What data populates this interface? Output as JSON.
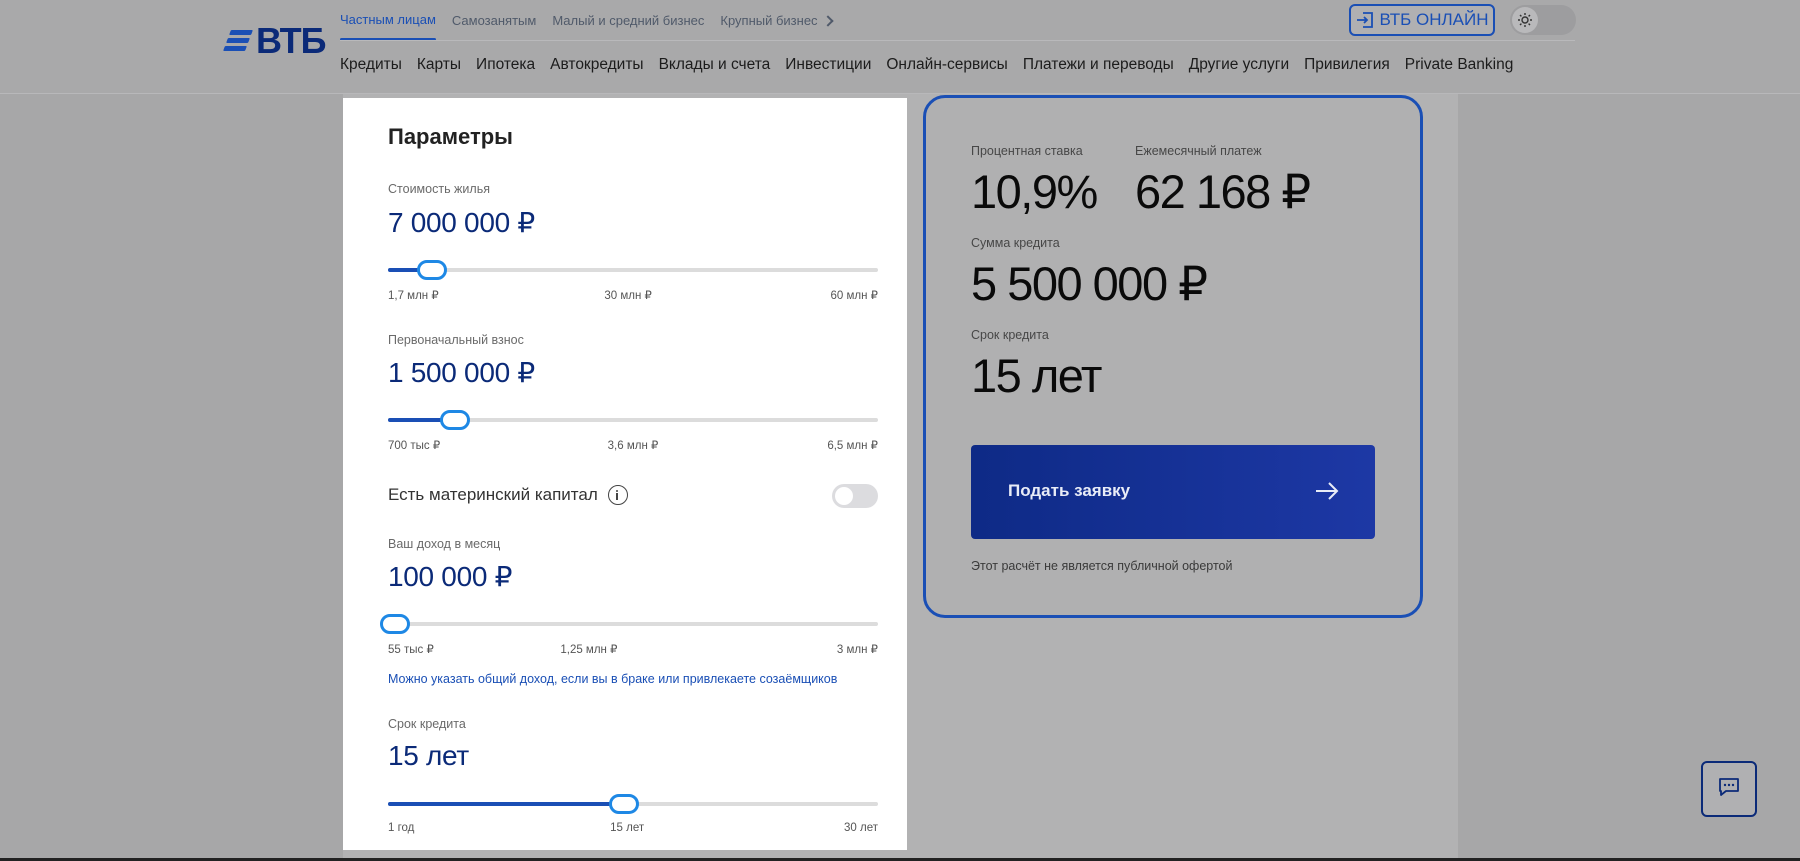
{
  "header": {
    "logo_text": "ВТБ",
    "segment_tabs": [
      {
        "label": "Частным лицам",
        "active": true
      },
      {
        "label": "Самозанятым",
        "active": false
      },
      {
        "label": "Малый и средний бизнес",
        "active": false
      },
      {
        "label": "Крупный бизнес",
        "active": false
      }
    ],
    "online_button": "ВТБ ОНЛАЙН",
    "theme_toggle_icon": "sun-icon",
    "nav": [
      "Кредиты",
      "Карты",
      "Ипотека",
      "Автокредиты",
      "Вклады и счета",
      "Инвестиции",
      "Онлайн-сервисы",
      "Платежи и переводы",
      "Другие услуги",
      "Привилегия",
      "Private Banking"
    ]
  },
  "params": {
    "title": "Параметры",
    "fields": [
      {
        "label": "Стоимость жилья",
        "value": "7 000 000 ₽",
        "slider_fraction": 0.09,
        "ticks": [
          "1,7 млн ₽",
          "30 млн ₽",
          "60 млн ₽"
        ],
        "mid_tick_fraction": 0.49
      },
      {
        "label": "Первоначальный взнос",
        "value": "1 500 000 ₽",
        "slider_fraction": 0.137,
        "ticks": [
          "700 тыс ₽",
          "3,6 млн ₽",
          "6,5 млн ₽"
        ],
        "mid_tick_fraction": 0.5
      },
      {
        "label": "Ваш доход в месяц",
        "value": "100 000 ₽",
        "slider_fraction": 0.015,
        "ticks": [
          "55 тыс ₽",
          "1,25 млн ₽",
          "3 млн ₽"
        ],
        "mid_tick_fraction": 0.41
      },
      {
        "label": "Срок кредита",
        "value": "15 лет",
        "slider_fraction": 0.482,
        "ticks": [
          "1 год",
          "15 лет",
          "30 лет"
        ],
        "mid_tick_fraction": 0.488
      }
    ],
    "maternity_capital": {
      "label": "Есть материнский капитал",
      "enabled": false
    },
    "income_hint": "Можно указать общий доход, если вы в браке или привлекаете созаёмщиков"
  },
  "result": {
    "rate_label": "Процентная ставка",
    "rate_value": "10,9%",
    "payment_label": "Ежемесячный платеж",
    "payment_value": "62 168 ₽",
    "amount_label": "Сумма кредита",
    "amount_value": "5 500 000 ₽",
    "term_label": "Срок кредита",
    "term_value": "15 лет",
    "apply_button": "Подать заявку",
    "offer_note": "Этот расчёт не является публичной офертой"
  },
  "colors": {
    "accent": "#1a4fb5",
    "brand_dark": "#0b2a78",
    "thumb": "#1e88e5"
  }
}
